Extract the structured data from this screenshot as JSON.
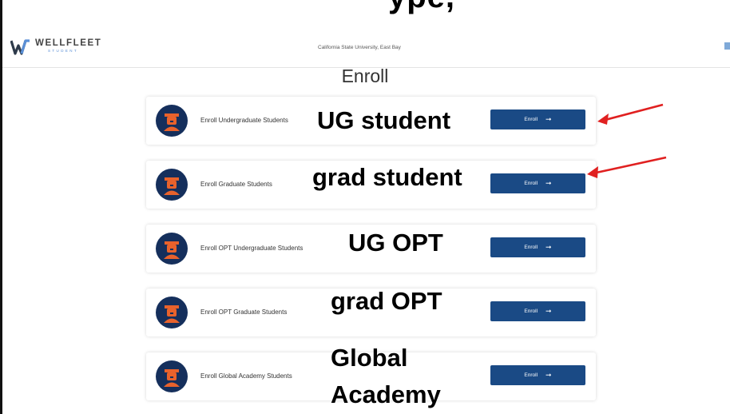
{
  "slide_title_fragment": "ype,",
  "header": {
    "logo_name": "WELLFLEET",
    "logo_sub": "STUDENT",
    "university": "California State University, East Bay"
  },
  "page_heading": "Enroll",
  "cards": [
    {
      "label": "Enroll Undergraduate Students",
      "button": "Enroll",
      "annotation": "UG student"
    },
    {
      "label": "Enroll Graduate Students",
      "button": "Enroll",
      "annotation": "grad student"
    },
    {
      "label": "Enroll OPT Undergraduate Students",
      "button": "Enroll",
      "annotation": "UG OPT"
    },
    {
      "label": "Enroll OPT Graduate Students",
      "button": "Enroll",
      "annotation": "grad OPT"
    },
    {
      "label": "Enroll Global Academy Students",
      "button": "Enroll",
      "annotation_line1": "Global",
      "annotation_line2": "Academy"
    }
  ],
  "icons": {
    "button_arrow": "arrow-right-icon",
    "avatar": "graduate-icon"
  },
  "colors": {
    "button": "#1a4a85",
    "avatar": "#152f5c",
    "avatar_accent": "#e8622c",
    "annotation_arrow": "#e02020"
  }
}
